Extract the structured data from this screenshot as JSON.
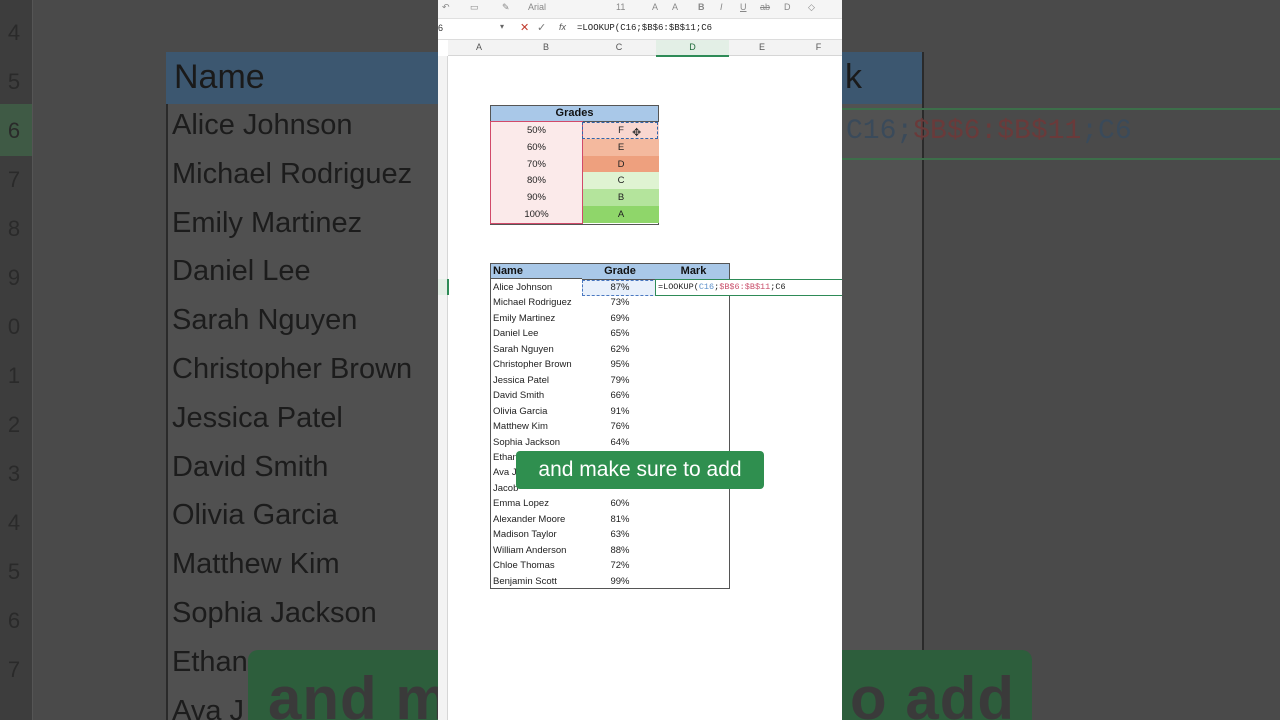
{
  "app": {
    "font_name": "Arial",
    "font_size": "11"
  },
  "formula_bar": {
    "name_box": "6",
    "formula": "=LOOKUP(C16;$B$6:$B$11;C6"
  },
  "columns": [
    "A",
    "B",
    "C",
    "D",
    "E",
    "F"
  ],
  "grades_table": {
    "title": "Grades",
    "rows": [
      {
        "pct": "50%",
        "grade": "F",
        "color": "#f9d7d0"
      },
      {
        "pct": "60%",
        "grade": "E",
        "color": "#f4b99e"
      },
      {
        "pct": "70%",
        "grade": "D",
        "color": "#eea07e"
      },
      {
        "pct": "80%",
        "grade": "C",
        "color": "#dff3d2"
      },
      {
        "pct": "90%",
        "grade": "B",
        "color": "#b4e49c"
      },
      {
        "pct": "100%",
        "grade": "A",
        "color": "#8fd66a"
      }
    ]
  },
  "main_table": {
    "headers": {
      "name": "Name",
      "grade": "Grade",
      "mark": "Mark"
    },
    "rows": [
      {
        "name": "Alice Johnson",
        "grade": "87%"
      },
      {
        "name": "Michael Rodriguez",
        "grade": "73%"
      },
      {
        "name": "Emily Martinez",
        "grade": "69%"
      },
      {
        "name": "Daniel Lee",
        "grade": "65%"
      },
      {
        "name": "Sarah Nguyen",
        "grade": "62%"
      },
      {
        "name": "Christopher Brown",
        "grade": "95%"
      },
      {
        "name": "Jessica Patel",
        "grade": "79%"
      },
      {
        "name": "David Smith",
        "grade": "66%"
      },
      {
        "name": "Olivia Garcia",
        "grade": "91%"
      },
      {
        "name": "Matthew Kim",
        "grade": "76%"
      },
      {
        "name": "Sophia Jackson",
        "grade": "64%"
      },
      {
        "name": "Ethan",
        "grade": ""
      },
      {
        "name": "Ava J",
        "grade": ""
      },
      {
        "name": "Jacob",
        "grade": ""
      },
      {
        "name": "Emma Lopez",
        "grade": "60%"
      },
      {
        "name": "Alexander Moore",
        "grade": "81%"
      },
      {
        "name": "Madison Taylor",
        "grade": "63%"
      },
      {
        "name": "William Anderson",
        "grade": "88%"
      },
      {
        "name": "Chloe Thomas",
        "grade": "72%"
      },
      {
        "name": "Benjamin Scott",
        "grade": "99%"
      }
    ]
  },
  "formula_cell": {
    "prefix": "=LOOKUP(",
    "ref1": "C16",
    "sep1": ";",
    "ref2": "$B$6:$B$11",
    "sep2": ";",
    "ref3": "C6"
  },
  "caption": "and make sure to add",
  "background": {
    "header": "Name",
    "header_right": "k",
    "names": [
      "Alice Johnson",
      "Michael Rodriguez",
      "Emily Martinez",
      "Daniel Lee",
      "Sarah Nguyen",
      "Christopher Brown",
      "Jessica Patel",
      "David Smith",
      "Olivia Garcia",
      "Matthew Kim",
      "Sophia Jackson",
      "Ethan",
      "Ava J"
    ],
    "row_numbers": [
      "4",
      "5",
      "6",
      "7",
      "8",
      "9",
      "0",
      "1",
      "2",
      "3",
      "4",
      "5",
      "6",
      "7"
    ],
    "formula_parts": {
      "a": "C16;",
      "b": "$B$6:$B$11",
      "c": ";C6"
    },
    "caption_left": "and m",
    "caption_right": "o add"
  }
}
